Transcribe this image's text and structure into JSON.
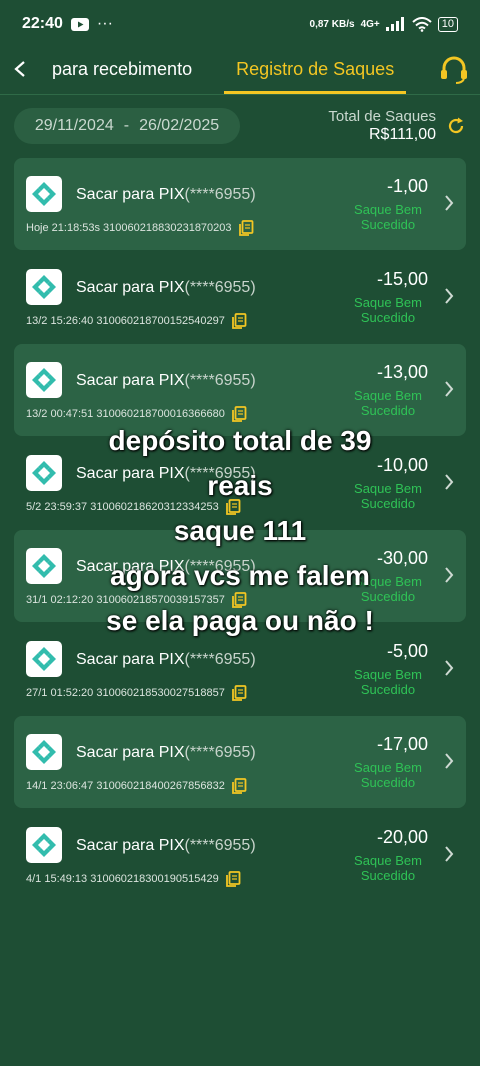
{
  "status_bar": {
    "time": "22:40",
    "extra": "···",
    "speed": "0,87 KB/s",
    "network": "4G+",
    "battery": "10"
  },
  "header": {
    "tab_receive": "para recebimento",
    "tab_withdrawals": "Registro de Saques",
    "accent": "#f3c623"
  },
  "filter": {
    "start_date": "29/11/2024",
    "separator": "-",
    "end_date": "26/02/2025"
  },
  "summary": {
    "label": "Total de Saques",
    "value": "R$111,00"
  },
  "withdrawals": [
    {
      "title": "Sacar para PIX",
      "masked": "(****6955)",
      "meta": "Hoje 21:18:53s 310060218830231870203",
      "amount": "-1,00",
      "status_line1": "Saque Bem",
      "status_line2": "Sucedido"
    },
    {
      "title": "Sacar para PIX",
      "masked": "(****6955)",
      "meta": "13/2 15:26:40 310060218700152540297",
      "amount": "-15,00",
      "status_line1": "Saque Bem",
      "status_line2": "Sucedido"
    },
    {
      "title": "Sacar para PIX",
      "masked": "(****6955)",
      "meta": "13/2 00:47:51 310060218700016366680",
      "amount": "-13,00",
      "status_line1": "Saque Bem",
      "status_line2": "Sucedido"
    },
    {
      "title": "Sacar para PIX",
      "masked": "(****6955)",
      "meta": "5/2 23:59:37 310060218620312334253",
      "amount": "-10,00",
      "status_line1": "Saque Bem",
      "status_line2": "Sucedido"
    },
    {
      "title": "Sacar para PIX",
      "masked": "(****6955)",
      "meta": "31/1 02:12:20 310060218570039157357",
      "amount": "-30,00",
      "status_line1": "Saque Bem",
      "status_line2": "Sucedido"
    },
    {
      "title": "Sacar para PIX",
      "masked": "(****6955)",
      "meta": "27/1 01:52:20 310060218530027518857",
      "amount": "-5,00",
      "status_line1": "Saque Bem",
      "status_line2": "Sucedido"
    },
    {
      "title": "Sacar para PIX",
      "masked": "(****6955)",
      "meta": "14/1 23:06:47 310060218400267856832",
      "amount": "-17,00",
      "status_line1": "Saque Bem",
      "status_line2": "Sucedido"
    },
    {
      "title": "Sacar para PIX",
      "masked": "(****6955)",
      "meta": "4/1 15:49:13 310060218300190515429",
      "amount": "-20,00",
      "status_line1": "Saque Bem",
      "status_line2": "Sucedido"
    }
  ],
  "overlay_caption": {
    "line1": "depósito total de 39",
    "line2": "reais",
    "line3": "saque 111",
    "line4": "agora vcs me falem",
    "line5": "se ela paga ou não !"
  },
  "colors": {
    "background": "#1e4e34",
    "row_shade": "#2c6345",
    "success": "#2fc256",
    "pix": "#32bcad"
  }
}
